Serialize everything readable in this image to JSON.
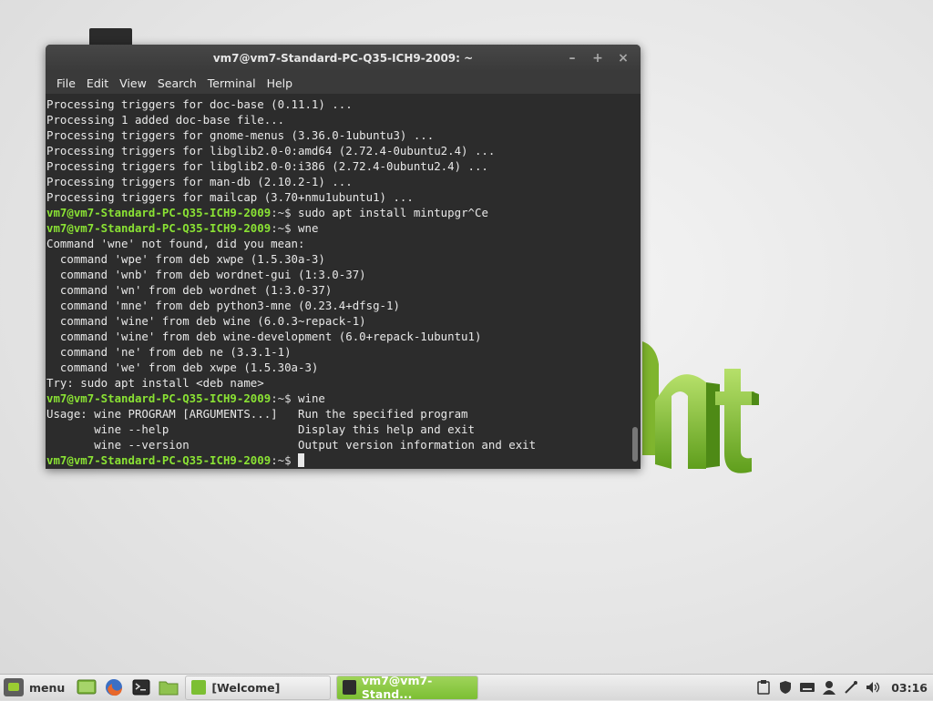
{
  "window": {
    "title": "vm7@vm7-Standard-PC-Q35-ICH9-2009: ~",
    "controls": {
      "minimize": "–",
      "maximize": "+",
      "close": "×"
    }
  },
  "menubar": [
    "File",
    "Edit",
    "View",
    "Search",
    "Terminal",
    "Help"
  ],
  "terminal": {
    "prompt_user": "vm7@vm7-Standard-PC-Q35-ICH9-2009",
    "prompt_path": ":~$ ",
    "lines": [
      {
        "text": "Processing triggers for doc-base (0.11.1) ..."
      },
      {
        "text": "Processing 1 added doc-base file..."
      },
      {
        "text": "Processing triggers for gnome-menus (3.36.0-1ubuntu3) ..."
      },
      {
        "text": "Processing triggers for libglib2.0-0:amd64 (2.72.4-0ubuntu2.4) ..."
      },
      {
        "text": "Processing triggers for libglib2.0-0:i386 (2.72.4-0ubuntu2.4) ..."
      },
      {
        "text": "Processing triggers for man-db (2.10.2-1) ..."
      },
      {
        "text": "Processing triggers for mailcap (3.70+nmu1ubuntu1) ..."
      },
      {
        "prompt": true,
        "text": "sudo apt install mintupgr^Ce"
      },
      {
        "prompt": true,
        "text": "wne"
      },
      {
        "text": "Command 'wne' not found, did you mean:"
      },
      {
        "text": "  command 'wpe' from deb xwpe (1.5.30a-3)"
      },
      {
        "text": "  command 'wnb' from deb wordnet-gui (1:3.0-37)"
      },
      {
        "text": "  command 'wn' from deb wordnet (1:3.0-37)"
      },
      {
        "text": "  command 'mne' from deb python3-mne (0.23.4+dfsg-1)"
      },
      {
        "text": "  command 'wine' from deb wine (6.0.3~repack-1)"
      },
      {
        "text": "  command 'wine' from deb wine-development (6.0+repack-1ubuntu1)"
      },
      {
        "text": "  command 'ne' from deb ne (3.3.1-1)"
      },
      {
        "text": "  command 'we' from deb xwpe (1.5.30a-3)"
      },
      {
        "text": "Try: sudo apt install <deb name>"
      },
      {
        "prompt": true,
        "text": "wine"
      },
      {
        "text": "Usage: wine PROGRAM [ARGUMENTS...]   Run the specified program"
      },
      {
        "text": "       wine --help                   Display this help and exit"
      },
      {
        "text": "       wine --version                Output version information and exit"
      },
      {
        "prompt": true,
        "text": "",
        "cursor": true
      }
    ]
  },
  "taskbar": {
    "menu_label": "menu",
    "launchers": [
      "show-desktop-icon",
      "firefox-icon",
      "terminal-icon",
      "files-icon"
    ],
    "tasks": [
      {
        "label": "[Welcome]",
        "icon": "mint-welcome-icon"
      },
      {
        "label": "vm7@vm7-Stand...",
        "icon": "terminal-icon"
      }
    ],
    "tray": [
      "clipboard-icon",
      "shield-icon",
      "keyboard-icon",
      "user-icon",
      "network-icon",
      "volume-icon"
    ],
    "clock": "03:16"
  },
  "colors": {
    "prompt_green": "#8ae234",
    "mint_green": "#87c540",
    "terminal_bg": "#2c2c2c"
  }
}
